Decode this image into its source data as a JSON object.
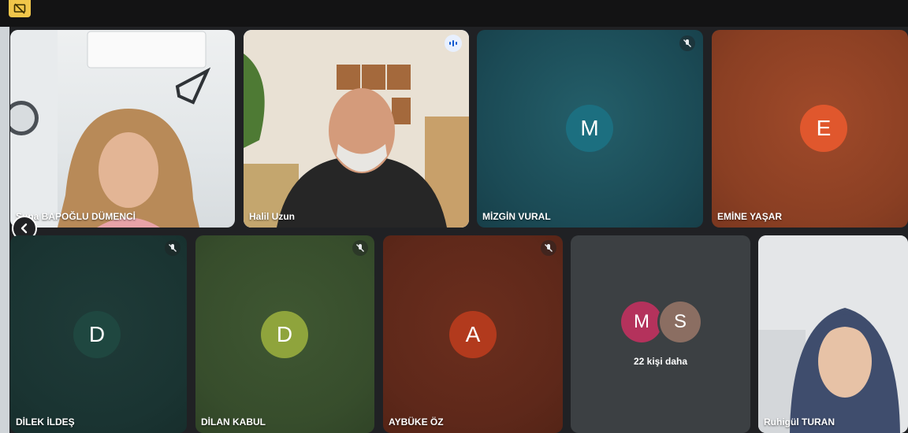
{
  "participants": [
    {
      "name": "Suna BAPOĞLU DÜMENCİ",
      "type": "video"
    },
    {
      "name": "Halil Uzun",
      "type": "video",
      "speaking": true
    },
    {
      "name": "MİZGİN VURAL",
      "type": "avatar",
      "initial": "M",
      "muted": true,
      "avatar_color": "#1c6f80"
    },
    {
      "name": "EMİNE YAŞAR",
      "type": "avatar",
      "initial": "E",
      "avatar_color": "#e0572d"
    },
    {
      "name": "DİLEK İLDEŞ",
      "type": "avatar",
      "initial": "D",
      "muted": true,
      "avatar_color": "#1f4740"
    },
    {
      "name": "DİLAN KABUL",
      "type": "avatar",
      "initial": "D",
      "muted": true,
      "avatar_color": "#8fa43c"
    },
    {
      "name": "AYBÜKE ÖZ",
      "type": "avatar",
      "initial": "A",
      "muted": true,
      "avatar_color": "#b23a1d"
    },
    {
      "name": "Ruhigül TURAN",
      "type": "video"
    }
  ],
  "overflow": {
    "label": "22 kişi daha",
    "avatars": [
      {
        "initial": "M",
        "color": "#b4325c"
      },
      {
        "initial": "S",
        "color": "#8b6e62"
      }
    ]
  },
  "icons": {
    "nav": "chevron-left-icon",
    "muted": "mic-off-icon",
    "speaking": "audio-level-icon",
    "corner": "presentation-off-icon"
  }
}
